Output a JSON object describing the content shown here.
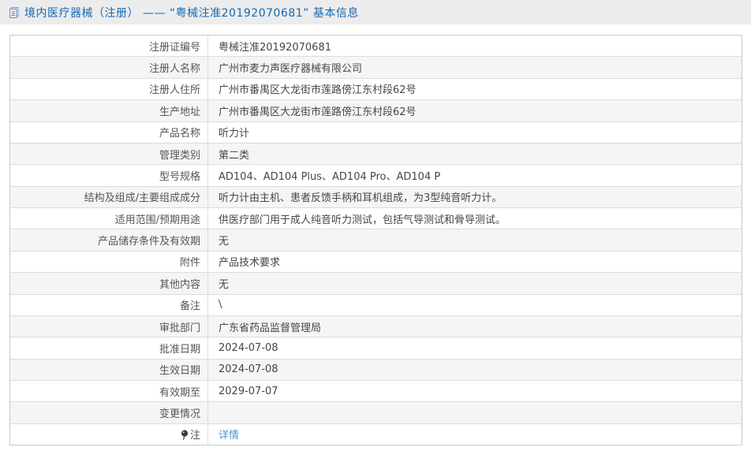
{
  "header": {
    "icon": "document-icon",
    "title": "境内医疗器械（注册） —— “粤械注准20192070681” 基本信息"
  },
  "table": {
    "rows": [
      {
        "label": "注册证编号",
        "value": "粤械注准20192070681"
      },
      {
        "label": "注册人名称",
        "value": "广州市麦力声医疗器械有限公司"
      },
      {
        "label": "注册人住所",
        "value": "广州市番禺区大龙街市莲路傍江东村段62号"
      },
      {
        "label": "生产地址",
        "value": "广州市番禺区大龙街市莲路傍江东村段62号"
      },
      {
        "label": "产品名称",
        "value": "听力计"
      },
      {
        "label": "管理类别",
        "value": "第二类"
      },
      {
        "label": "型号规格",
        "value": "AD104、AD104 Plus、AD104 Pro、AD104 P"
      },
      {
        "label": "结构及组成/主要组成成分",
        "value": "听力计由主机、患者反馈手柄和耳机组成，为3型纯音听力计。"
      },
      {
        "label": "适用范围/预期用途",
        "value": "供医疗部门用于成人纯音听力测试，包括气导测试和骨导测试。"
      },
      {
        "label": "产品储存条件及有效期",
        "value": "无"
      },
      {
        "label": "附件",
        "value": "产品技术要求"
      },
      {
        "label": "其他内容",
        "value": "无"
      },
      {
        "label": "备注",
        "value": "\\"
      },
      {
        "label": "审批部门",
        "value": "广东省药品监督管理局"
      },
      {
        "label": "批准日期",
        "value": "2024-07-08"
      },
      {
        "label": "生效日期",
        "value": "2024-07-08"
      },
      {
        "label": "有效期至",
        "value": "2029-07-07"
      },
      {
        "label": "变更情况",
        "value": ""
      },
      {
        "label": "注",
        "value": "详情",
        "label_icon": "note-pin-icon",
        "is_link": true
      }
    ]
  },
  "colors": {
    "header_bg": "#ececec",
    "header_text": "#1569b3",
    "stripe_bg": "#f5f5f5",
    "border": "#c9c9c9",
    "label_text": "#555555",
    "value_text": "#464646",
    "link": "#5094d6"
  }
}
